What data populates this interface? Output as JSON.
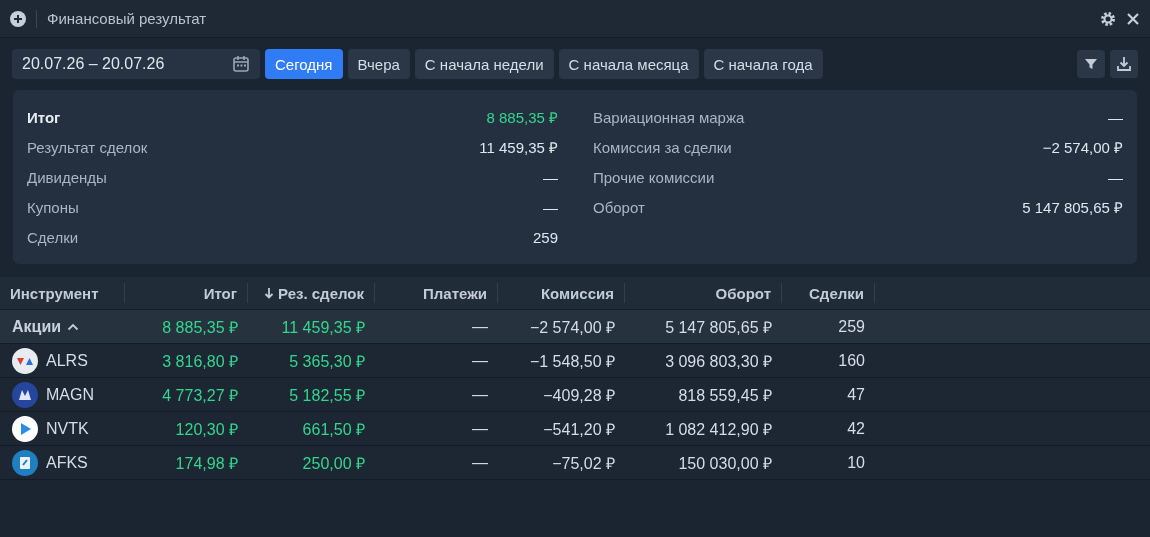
{
  "window": {
    "title": "Финансовый результат"
  },
  "date_range": {
    "value": "20.07.26 – 20.07.26"
  },
  "periods": [
    {
      "label": "Сегодня",
      "selected": true
    },
    {
      "label": "Вчера",
      "selected": false
    },
    {
      "label": "С начала недели",
      "selected": false
    },
    {
      "label": "С начала месяца",
      "selected": false
    },
    {
      "label": "С начала года",
      "selected": false
    }
  ],
  "summary": {
    "left": [
      {
        "label": "Итог",
        "value": "8 885,35 ₽",
        "kind": "total"
      },
      {
        "label": "Результат сделок",
        "value": "11 459,35 ₽",
        "kind": "plain"
      },
      {
        "label": "Дивиденды",
        "value": "—",
        "kind": "plain"
      },
      {
        "label": "Купоны",
        "value": "—",
        "kind": "plain"
      },
      {
        "label": "Сделки",
        "value": "259",
        "kind": "plain"
      }
    ],
    "right": [
      {
        "label": "Вариационная маржа",
        "value": "—",
        "kind": "plain"
      },
      {
        "label": "Комиссия за сделки",
        "value": "−2 574,00 ₽",
        "kind": "plain"
      },
      {
        "label": "Прочие комиссии",
        "value": "—",
        "kind": "plain"
      },
      {
        "label": "Оборот",
        "value": "5 147 805,65 ₽",
        "kind": "plain"
      }
    ]
  },
  "table": {
    "columns": [
      {
        "label": "Инструмент",
        "kind": "name"
      },
      {
        "label": "Итог",
        "kind": "profit"
      },
      {
        "label": "Рез. сделок",
        "kind": "profit",
        "sorted": true
      },
      {
        "label": "Платежи",
        "kind": "plain"
      },
      {
        "label": "Комиссия",
        "kind": "plain"
      },
      {
        "label": "Оборот",
        "kind": "plain"
      },
      {
        "label": "Сделки",
        "kind": "plain"
      }
    ],
    "rows": [
      {
        "kind": "group",
        "expanded": true,
        "cells": [
          "Акции",
          "8 885,35 ₽",
          "11 459,35 ₽",
          "—",
          "−2 574,00 ₽",
          "5 147 805,65 ₽",
          "259"
        ]
      },
      {
        "kind": "instrument",
        "cells": [
          "ALRS",
          "3 816,80 ₽",
          "5 365,30 ₽",
          "—",
          "−1 548,50 ₽",
          "3 096 803,30 ₽",
          "160"
        ]
      },
      {
        "kind": "instrument",
        "cells": [
          "MAGN",
          "4 773,27 ₽",
          "5 182,55 ₽",
          "—",
          "−409,28 ₽",
          "818 559,45 ₽",
          "47"
        ]
      },
      {
        "kind": "instrument",
        "cells": [
          "NVTK",
          "120,30 ₽",
          "661,50 ₽",
          "—",
          "−541,20 ₽",
          "1 082 412,90 ₽",
          "42"
        ]
      },
      {
        "kind": "instrument",
        "cells": [
          "AFKS",
          "174,98 ₽",
          "250,00 ₽",
          "—",
          "−75,02 ₽",
          "150 030,00 ₽",
          "10"
        ]
      }
    ]
  }
}
